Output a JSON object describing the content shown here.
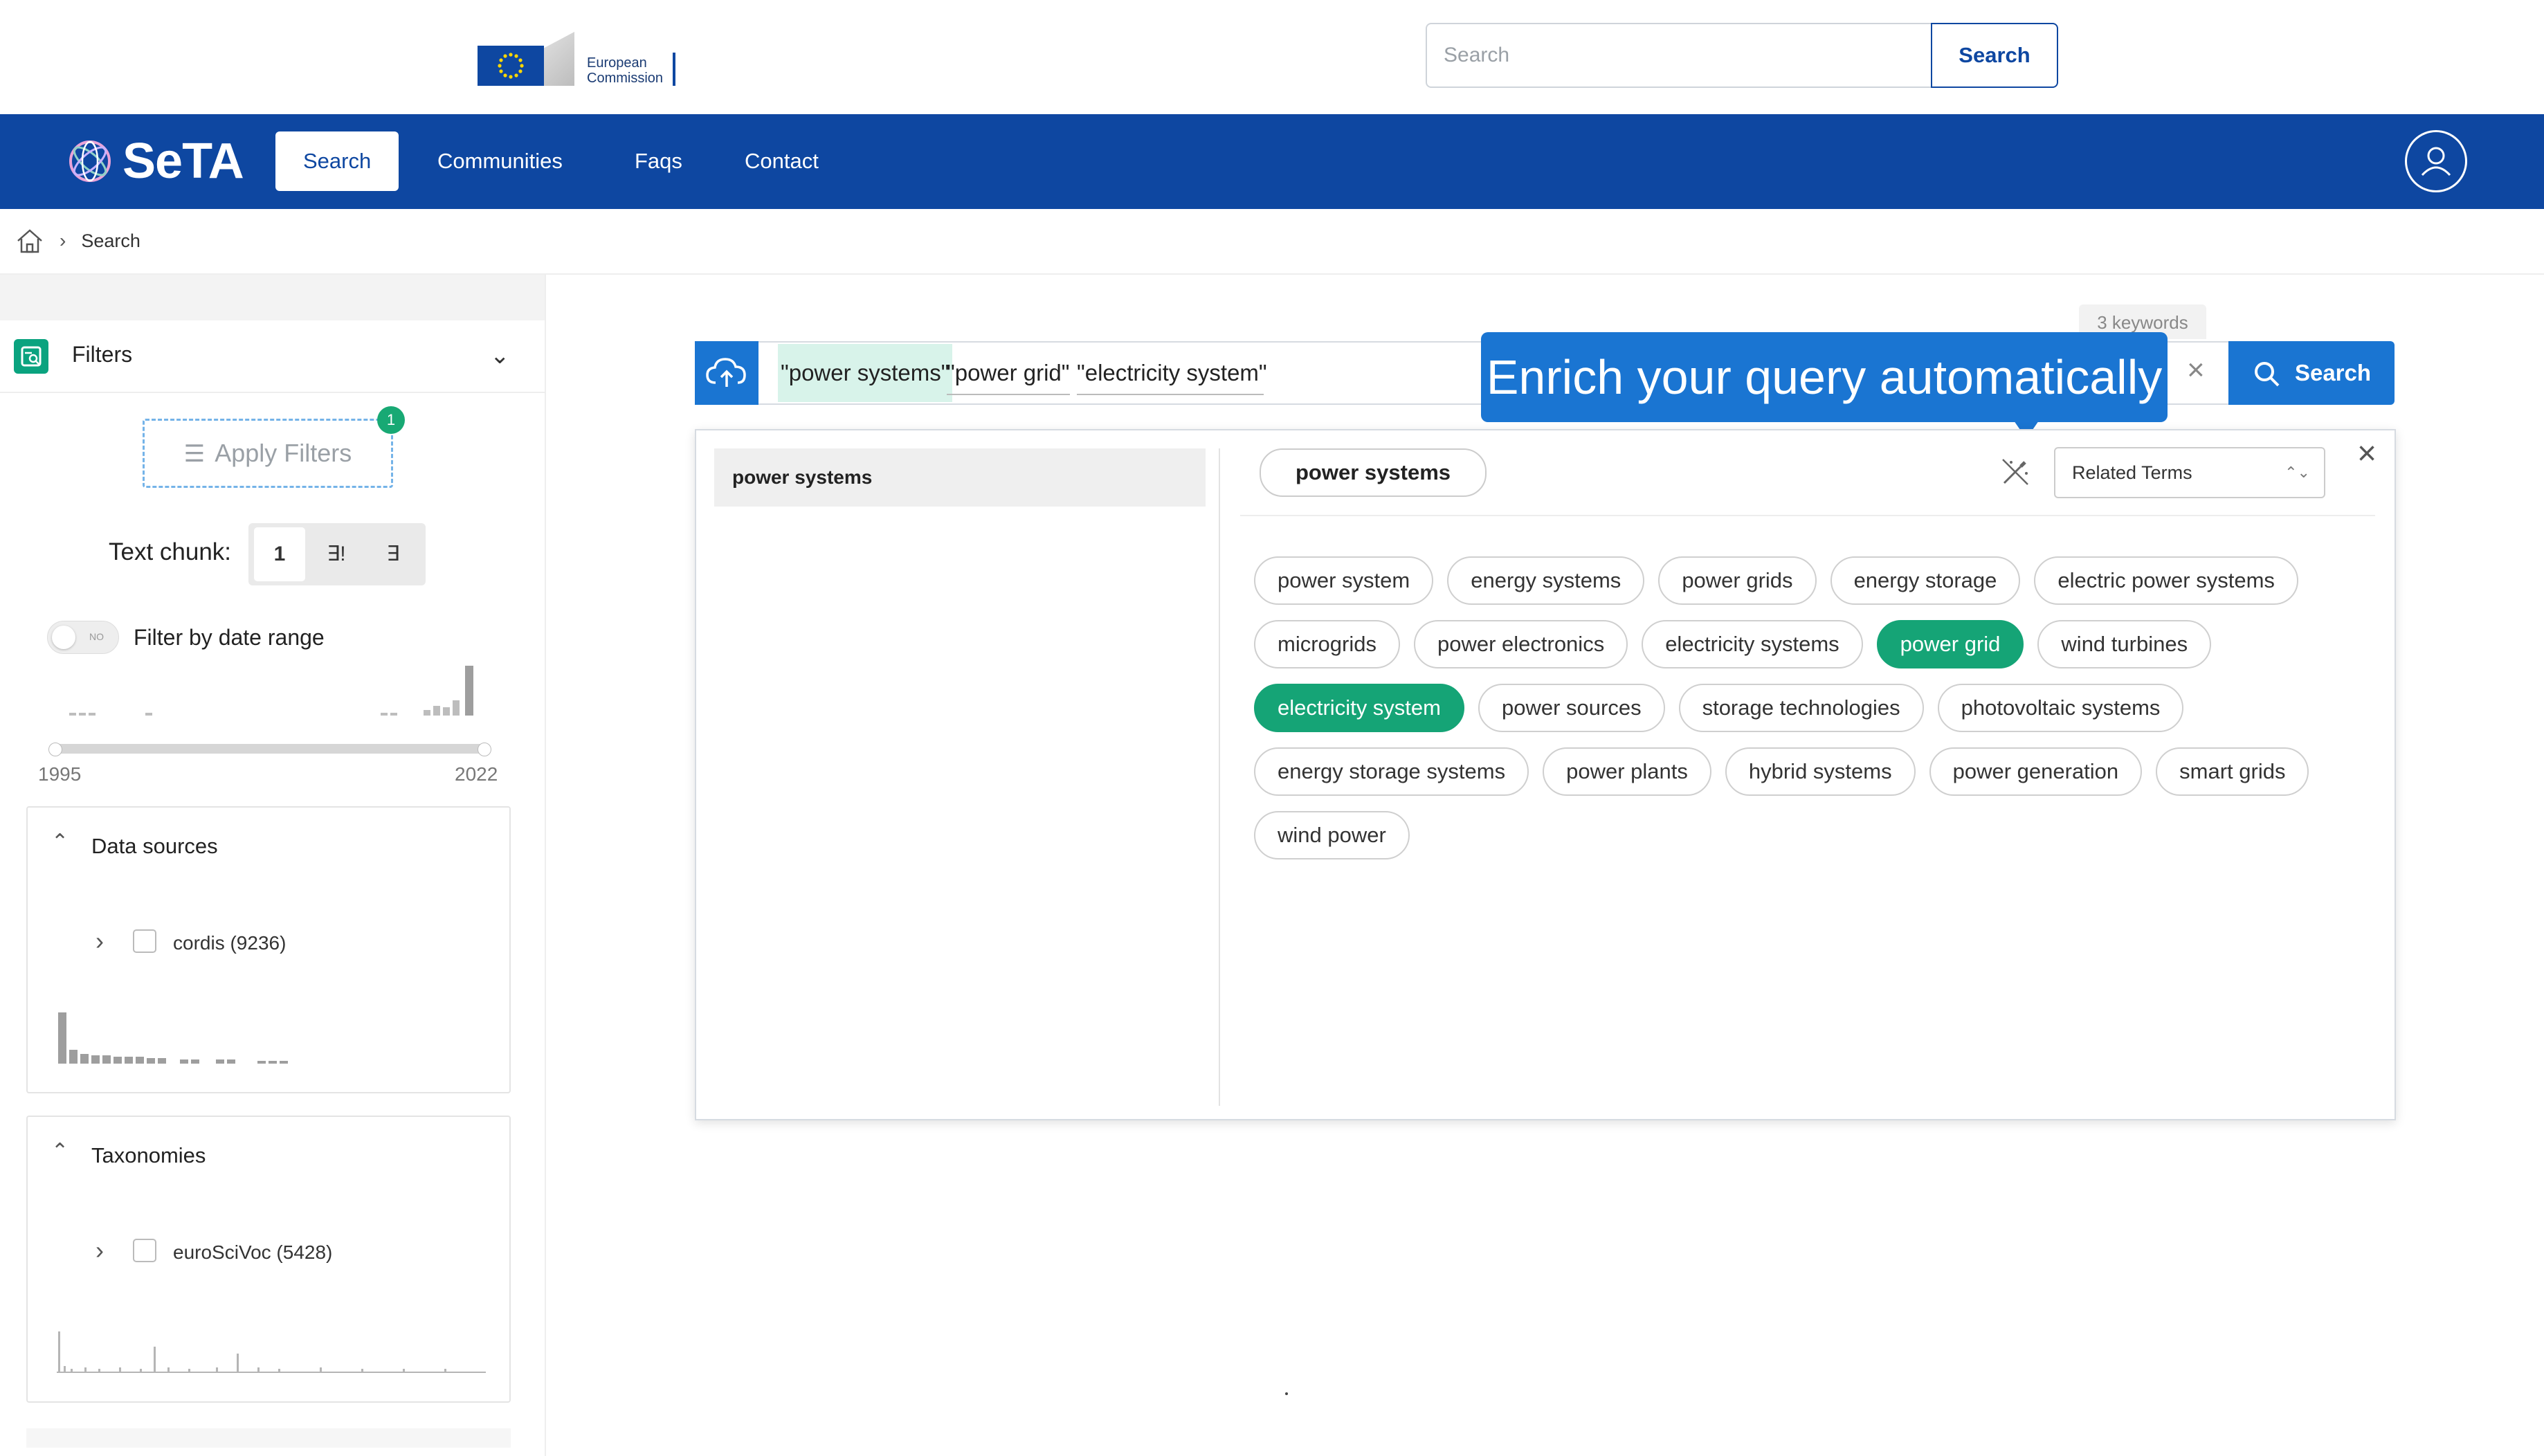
{
  "header": {
    "ec_logo_text_line1": "European",
    "ec_logo_text_line2": "Commission",
    "search_placeholder": "Search",
    "search_button": "Search"
  },
  "nav": {
    "brand": "SeTA",
    "items": [
      {
        "label": "Search",
        "active": true
      },
      {
        "label": "Communities",
        "active": false
      },
      {
        "label": "Faqs",
        "active": false
      },
      {
        "label": "Contact",
        "active": false
      }
    ],
    "avatar_icon": "user-icon",
    "color_primary": "#0e47a1"
  },
  "breadcrumb": {
    "home_icon": "home-icon",
    "current": "Search"
  },
  "sidebar": {
    "filters_label": "Filters",
    "apply_filters": "Apply Filters",
    "apply_badge": "1",
    "text_chunk_label": "Text chunk:",
    "text_chunk_options": [
      "1",
      "∃!",
      "∃"
    ],
    "text_chunk_selected": "1",
    "toggle_text": "NO",
    "filter_by_date": "Filter by date range",
    "year_start": "1995",
    "year_end": "2022",
    "data_sources": {
      "title": "Data sources",
      "item": "cordis (9236)"
    },
    "taxonomies": {
      "title": "Taxonomies",
      "item": "euroSciVoc (5428)"
    }
  },
  "query": {
    "keywords_badge": "3 keywords",
    "terms": [
      "\"power systems\"",
      "\"power grid\"",
      "\"electricity system\""
    ],
    "tooltip": "Enrich your query automatically",
    "search_button": "Search",
    "accent_color": "#1a75d2"
  },
  "enrich": {
    "left_item": "power systems",
    "selected_term": "power systems",
    "mode_select": "Related Terms",
    "chips": [
      {
        "label": "power system",
        "selected": false
      },
      {
        "label": "energy systems",
        "selected": false
      },
      {
        "label": "power grids",
        "selected": false
      },
      {
        "label": "energy storage",
        "selected": false
      },
      {
        "label": "electric power systems",
        "selected": false
      },
      {
        "label": "microgrids",
        "selected": false
      },
      {
        "label": "power electronics",
        "selected": false
      },
      {
        "label": "electricity systems",
        "selected": false
      },
      {
        "label": "power grid",
        "selected": true
      },
      {
        "label": "wind turbines",
        "selected": false
      },
      {
        "label": "electricity system",
        "selected": true
      },
      {
        "label": "power sources",
        "selected": false
      },
      {
        "label": "storage technologies",
        "selected": false
      },
      {
        "label": "photovoltaic systems",
        "selected": false
      },
      {
        "label": "energy storage systems",
        "selected": false
      },
      {
        "label": "power plants",
        "selected": false
      },
      {
        "label": "hybrid systems",
        "selected": false
      },
      {
        "label": "power generation",
        "selected": false
      },
      {
        "label": "smart grids",
        "selected": false
      },
      {
        "label": "wind power",
        "selected": false
      }
    ],
    "selected_color": "#15a476"
  }
}
